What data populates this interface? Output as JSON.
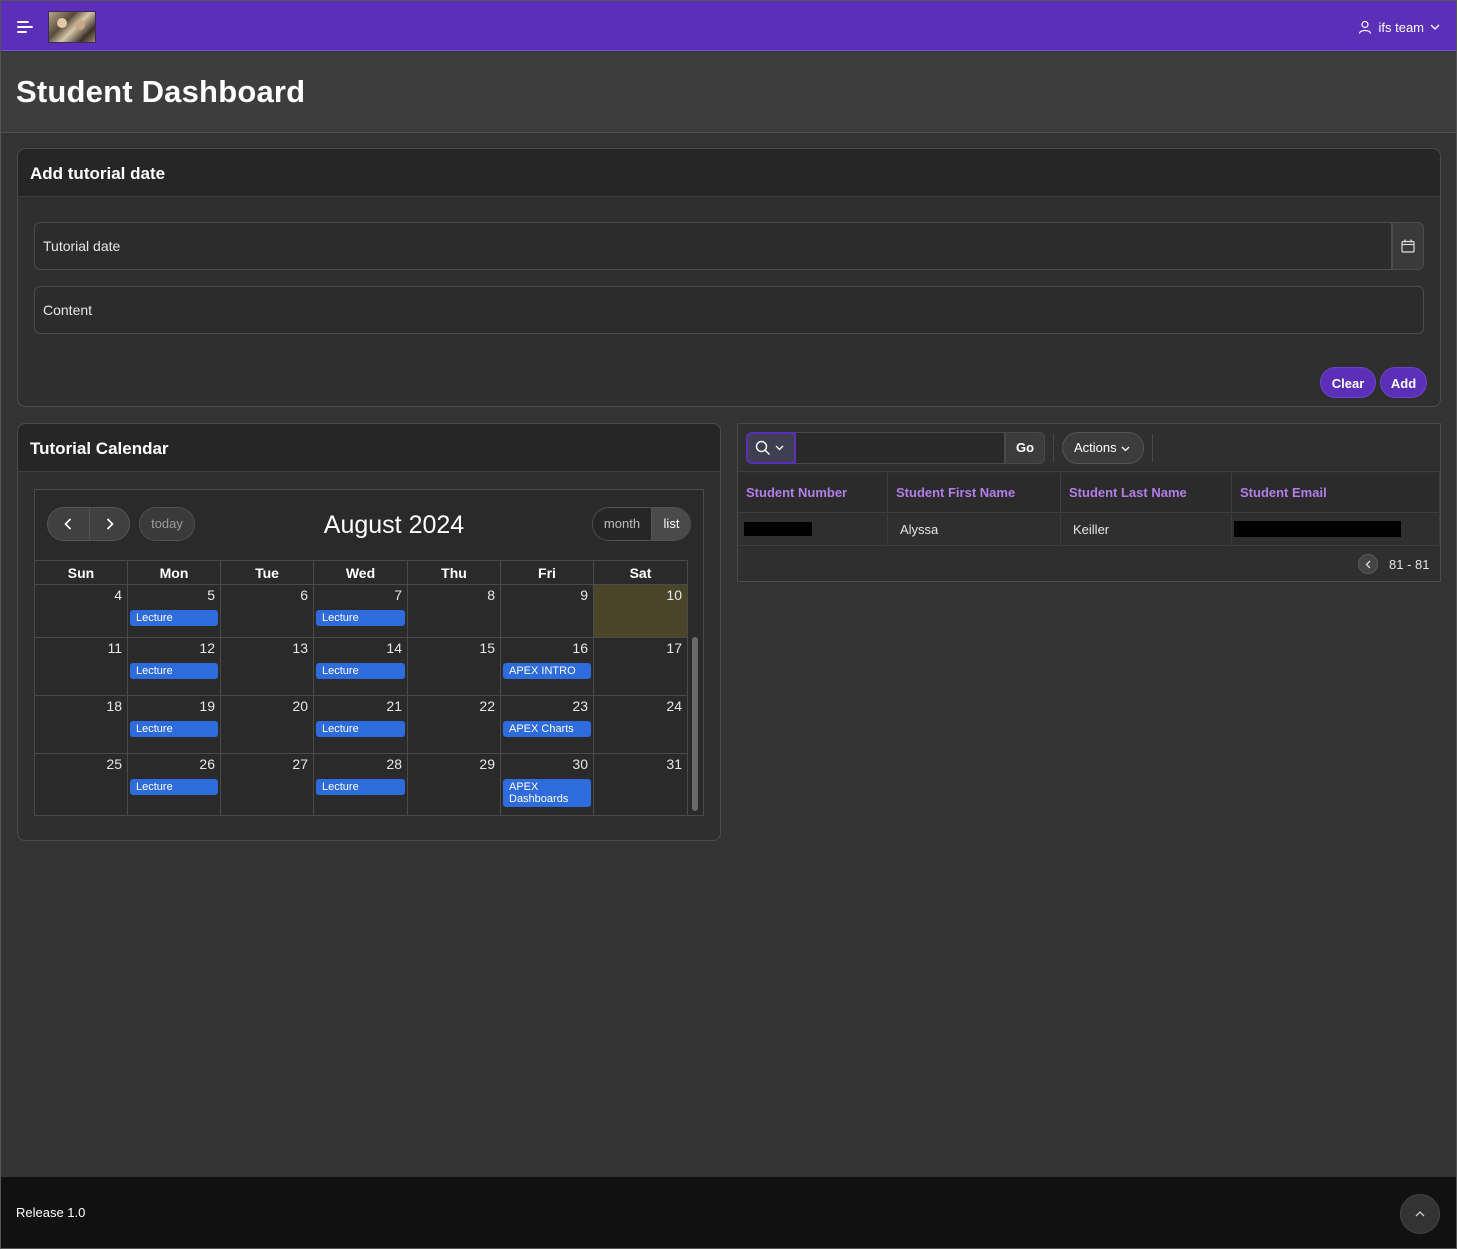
{
  "header": {
    "user_label": "ifs team"
  },
  "page": {
    "title": "Student Dashboard"
  },
  "add_region": {
    "title": "Add tutorial date",
    "tutorial_date_label": "Tutorial date",
    "content_label": "Content",
    "clear_label": "Clear",
    "add_label": "Add"
  },
  "calendar": {
    "title": "Tutorial Calendar",
    "month_title": "August 2024",
    "today_label": "today",
    "view_month_label": "month",
    "view_list_label": "list",
    "weekdays": [
      "Sun",
      "Mon",
      "Tue",
      "Wed",
      "Thu",
      "Fri",
      "Sat"
    ],
    "highlight_color": "#4a4428",
    "event_color": "#2e6bdc",
    "weeks": [
      {
        "days": [
          {
            "n": "4",
            "event": ""
          },
          {
            "n": "5",
            "event": "Lecture"
          },
          {
            "n": "6",
            "event": ""
          },
          {
            "n": "7",
            "event": "Lecture"
          },
          {
            "n": "8",
            "event": ""
          },
          {
            "n": "9",
            "event": ""
          },
          {
            "n": "10",
            "event": "",
            "today": true
          }
        ]
      },
      {
        "days": [
          {
            "n": "11",
            "event": ""
          },
          {
            "n": "12",
            "event": "Lecture"
          },
          {
            "n": "13",
            "event": ""
          },
          {
            "n": "14",
            "event": "Lecture"
          },
          {
            "n": "15",
            "event": ""
          },
          {
            "n": "16",
            "event": "APEX INTRO"
          },
          {
            "n": "17",
            "event": ""
          }
        ]
      },
      {
        "days": [
          {
            "n": "18",
            "event": ""
          },
          {
            "n": "19",
            "event": "Lecture"
          },
          {
            "n": "20",
            "event": ""
          },
          {
            "n": "21",
            "event": "Lecture"
          },
          {
            "n": "22",
            "event": ""
          },
          {
            "n": "23",
            "event": "APEX Charts"
          },
          {
            "n": "24",
            "event": ""
          }
        ]
      },
      {
        "days": [
          {
            "n": "25",
            "event": ""
          },
          {
            "n": "26",
            "event": "Lecture"
          },
          {
            "n": "27",
            "event": ""
          },
          {
            "n": "28",
            "event": "Lecture"
          },
          {
            "n": "29",
            "event": ""
          },
          {
            "n": "30",
            "event": "APEX Dashboards"
          },
          {
            "n": "31",
            "event": ""
          }
        ]
      }
    ]
  },
  "report": {
    "go_label": "Go",
    "actions_label": "Actions",
    "columns": [
      "Student Number",
      "Student First Name",
      "Student Last Name",
      "Student Email"
    ],
    "rows": [
      {
        "first_name": "Alyssa",
        "last_name": "Keiller"
      }
    ],
    "pagination": "81 - 81"
  },
  "footer": {
    "release": "Release 1.0"
  },
  "colors": {
    "brand": "#5b2fb8",
    "header_link": "#b27ee8"
  }
}
